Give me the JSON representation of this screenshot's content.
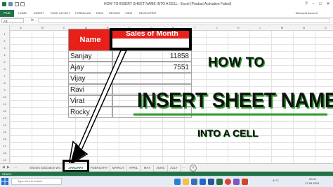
{
  "titlebar": {
    "title": "HOW TO INSERT SHEET NAME INTO A CELL - Excel (Product Activation Failed)",
    "qat_icons": [
      "save-icon",
      "undo-icon",
      "redo-icon"
    ],
    "help": "?",
    "minimize": "–",
    "restore": "□",
    "close": "✕"
  },
  "ribbon": {
    "file": "FILE",
    "tabs": [
      "HOME",
      "INSERT",
      "PAGE LAYOUT",
      "FORMULAS",
      "DATA",
      "REVIEW",
      "VIEW",
      "DEVELOPER"
    ],
    "account": "Microsoft account"
  },
  "formula_bar": {
    "name_box": "A3",
    "fx": "fx",
    "value": ""
  },
  "column_headers": [
    "A",
    "B",
    "C",
    "D",
    "E",
    "F",
    "G",
    "H",
    "I",
    "J",
    "K",
    "L",
    "M",
    "N",
    "O"
  ],
  "row_headers": [
    "1",
    "2",
    "3",
    "4",
    "5",
    "6",
    "7",
    "8",
    "9",
    "10",
    "11",
    "12",
    "13",
    "14",
    "15",
    "16",
    "17",
    "18",
    "19",
    "20"
  ],
  "table": {
    "name_header": "Name",
    "sales_header": "Sales of Month",
    "rows": [
      {
        "name": "Sanjay",
        "value": "11858"
      },
      {
        "name": "Ajay",
        "value": "7551"
      },
      {
        "name": "Vijay",
        "value": ""
      },
      {
        "name": "Ravi",
        "value": ""
      },
      {
        "name": "Virat",
        "value": ""
      },
      {
        "name": "Rocky",
        "value": ""
      }
    ]
  },
  "overlay": {
    "line1": "HOW TO",
    "line2": "INSERT SHEET NAME",
    "line3": "INTO A CELL",
    "accent": "#2c9a2c",
    "header_red": "#e8201a"
  },
  "sheet_tabs": {
    "tabs": [
      {
        "label": "Shivam Education Wo",
        "active": false
      },
      {
        "label": "JANUARY",
        "active": true
      },
      {
        "label": "FEBRUARY",
        "active": false
      },
      {
        "label": "MARCH",
        "active": false
      },
      {
        "label": "APRIL",
        "active": false
      },
      {
        "label": "MAY",
        "active": false
      },
      {
        "label": "JUNE",
        "active": false
      },
      {
        "label": "JULY",
        "active": false
      }
    ],
    "more": "...",
    "add": "+"
  },
  "statusbar": {
    "ready": "READY",
    "excel_green": "#217346"
  },
  "taskbar": {
    "search_placeholder": "Type here to search",
    "temperature": "41°C",
    "time": "20:41",
    "date": "17-05-2021",
    "app_icons": [
      "edge-icon",
      "file-explorer-icon",
      "store-icon",
      "mail-icon",
      "word-icon",
      "excel-icon",
      "chrome-icon",
      "photos-icon",
      "powerpoint-icon"
    ]
  }
}
